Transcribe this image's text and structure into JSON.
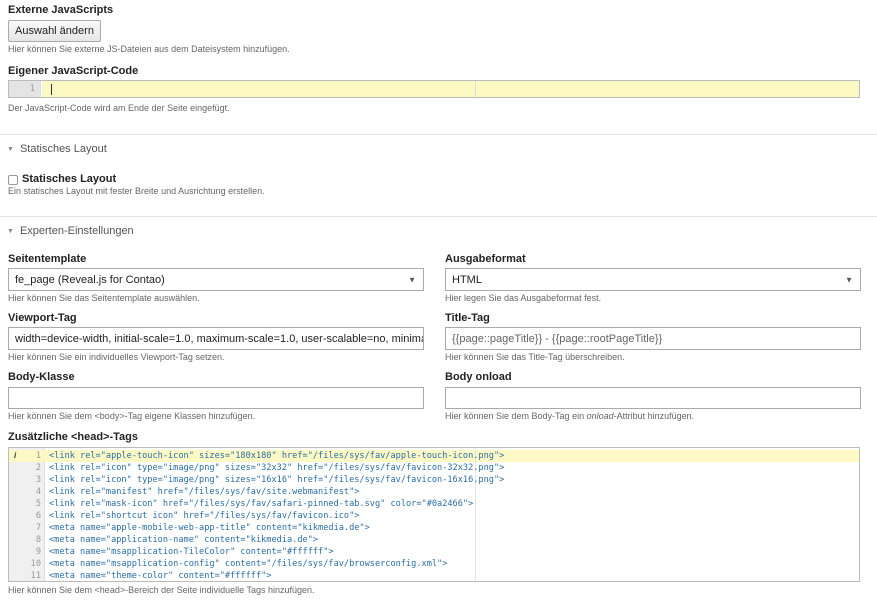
{
  "external_js": {
    "label": "Externe JavaScripts",
    "button": "Auswahl ändern",
    "help": "Hier können Sie externe JS-Dateien aus dem Dateisystem hinzufügen."
  },
  "custom_js": {
    "label": "Eigener JavaScript-Code",
    "line_number": "1",
    "help": "Der JavaScript-Code wird am Ende der Seite eingefügt."
  },
  "static_layout_section": {
    "legend": "Statisches Layout",
    "checkbox_label": "Statisches Layout",
    "checked": false,
    "help": "Ein statisches Layout mit fester Breite und Ausrichtung erstellen."
  },
  "expert_section": {
    "legend": "Experten-Einstellungen"
  },
  "page_template": {
    "label": "Seitentemplate",
    "value": "fe_page (Reveal.js for Contao)",
    "help": "Hier können Sie das Seitentemplate auswählen."
  },
  "output_format": {
    "label": "Ausgabeformat",
    "value": "HTML",
    "help": "Hier legen Sie das Ausgabeformat fest."
  },
  "viewport_tag": {
    "label": "Viewport-Tag",
    "value": "width=device-width, initial-scale=1.0, maximum-scale=1.0, user-scalable=no, minimal-ui",
    "help": "Hier können Sie ein individuelles Viewport-Tag setzen."
  },
  "title_tag": {
    "label": "Title-Tag",
    "placeholder": "{{page::pageTitle}} - {{page::rootPageTitle}}",
    "help": "Hier können Sie das Title-Tag überschreiben."
  },
  "body_class": {
    "label": "Body-Klasse",
    "value": "",
    "help": "Hier können Sie dem <body>-Tag eigene Klassen hinzufügen."
  },
  "body_onload": {
    "label": "Body onload",
    "value": "",
    "help_before": "Hier können Sie dem Body-Tag ein ",
    "help_em": "onload",
    "help_after": "-Attribut hinzufügen."
  },
  "head_tags": {
    "label": "Zusätzliche <head>-Tags",
    "info_marker": "i",
    "lines": [
      {
        "num": "1",
        "code": "<link rel=\"apple-touch-icon\" sizes=\"180x180\" href=\"/files/sys/fav/apple-touch-icon.png\">"
      },
      {
        "num": "2",
        "code": "<link rel=\"icon\" type=\"image/png\" sizes=\"32x32\" href=\"/files/sys/fav/favicon-32x32.png\">"
      },
      {
        "num": "3",
        "code": "<link rel=\"icon\" type=\"image/png\" sizes=\"16x16\" href=\"/files/sys/fav/favicon-16x16.png\">"
      },
      {
        "num": "4",
        "code": "<link rel=\"manifest\" href=\"/files/sys/fav/site.webmanifest\">"
      },
      {
        "num": "5",
        "code": "<link rel=\"mask-icon\" href=\"/files/sys/fav/safari-pinned-tab.svg\" color=\"#0a2466\">"
      },
      {
        "num": "6",
        "code": "<link rel=\"shortcut icon\" href=\"/files/sys/fav/favicon.ico\">"
      },
      {
        "num": "7",
        "code": "<meta name=\"apple-mobile-web-app-title\" content=\"kikmedia.de\">"
      },
      {
        "num": "8",
        "code": "<meta name=\"application-name\" content=\"kikmedia.de\">"
      },
      {
        "num": "9",
        "code": "<meta name=\"msapplication-TileColor\" content=\"#ffffff\">"
      },
      {
        "num": "10",
        "code": "<meta name=\"msapplication-config\" content=\"/files/sys/fav/browserconfig.xml\">"
      },
      {
        "num": "11",
        "code": "<meta name=\"theme-color\" content=\"#ffffff\">"
      }
    ],
    "help": "Hier können Sie dem <head>-Bereich der Seite individuelle Tags hinzufügen."
  },
  "colors": {
    "active_line": "#fcf9c5",
    "code_tag": "#2a6ea6"
  }
}
